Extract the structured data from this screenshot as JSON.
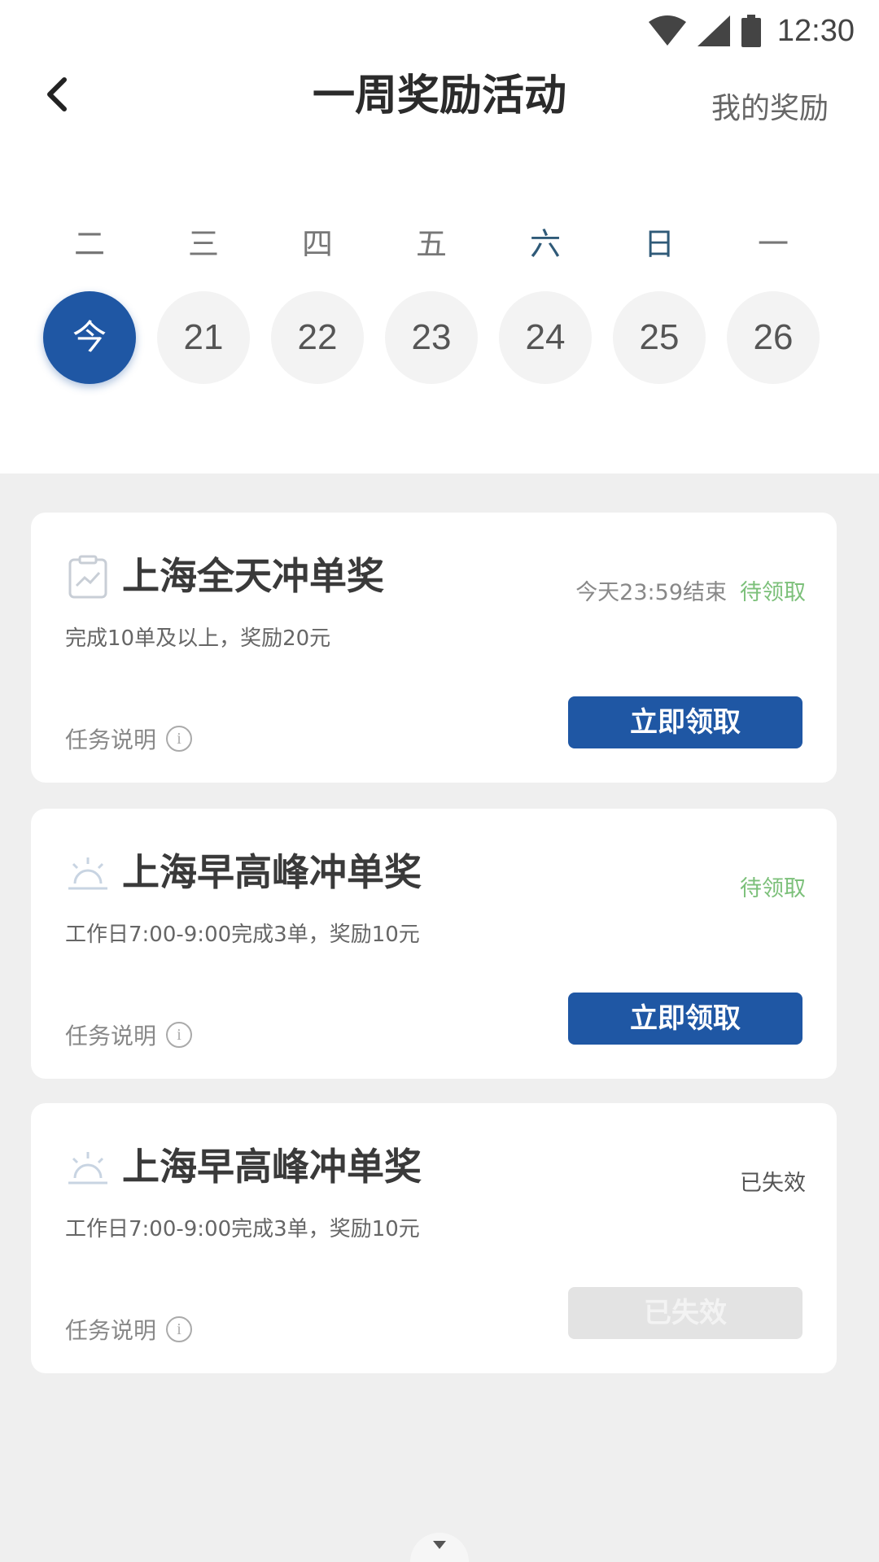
{
  "status_bar": {
    "time": "12:30"
  },
  "header": {
    "title": "一周奖励活动",
    "right_link": "我的奖励"
  },
  "week": {
    "days": [
      {
        "label": "二",
        "date": "今",
        "today": true
      },
      {
        "label": "三",
        "date": "21"
      },
      {
        "label": "四",
        "date": "22"
      },
      {
        "label": "五",
        "date": "23"
      },
      {
        "label": "六",
        "date": "24",
        "weekend": true
      },
      {
        "label": "日",
        "date": "25",
        "weekend": true
      },
      {
        "label": "一",
        "date": "26"
      }
    ]
  },
  "cards": [
    {
      "icon": "clipboard-chart-icon",
      "title": "上海全天冲单奖",
      "desc": "完成10单及以上，奖励20元",
      "deadline": "今天23:59结束",
      "status": "待领取",
      "task_label": "任务说明",
      "button": "立即领取",
      "status_color": "#7cc07a"
    },
    {
      "icon": "sunrise-icon",
      "title": "上海早高峰冲单奖",
      "desc": "工作日7:00-9:00完成3单，奖励10元",
      "deadline": "",
      "status": "待领取",
      "task_label": "任务说明",
      "button": "立即领取",
      "status_color": "#7cc07a"
    },
    {
      "icon": "sunrise-icon",
      "title": "上海早高峰冲单奖",
      "desc": "工作日7:00-9:00完成3单，奖励10元",
      "deadline": "",
      "status": "已失效",
      "task_label": "任务说明",
      "button": "已失效",
      "status_color": "#555555"
    }
  ],
  "colors": {
    "accent": "#1f57a4",
    "pending": "#7cc07a",
    "background": "#efefef"
  }
}
